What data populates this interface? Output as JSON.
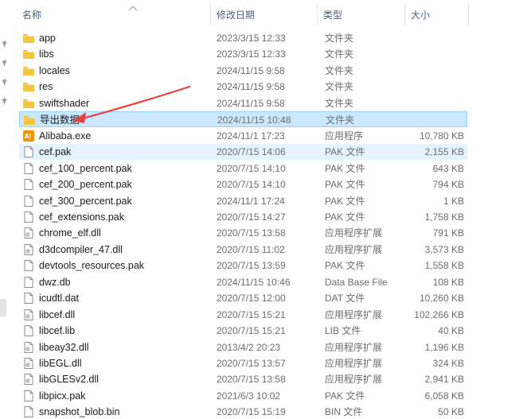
{
  "columns": {
    "name": "名称",
    "date": "修改日期",
    "type": "类型",
    "size": "大小"
  },
  "colors": {
    "folder": "#f5c542",
    "selected_bg": "#cce8ff",
    "hover_bg": "#e5f3ff",
    "arrow": "#e8413b",
    "header_text": "#4c607a"
  },
  "files": [
    {
      "name": "app",
      "date": "2023/3/15 12:33",
      "type": "文件夹",
      "size": "",
      "icon": "folder-icon",
      "state": ""
    },
    {
      "name": "libs",
      "date": "2023/3/15 12:33",
      "type": "文件夹",
      "size": "",
      "icon": "folder-icon",
      "state": ""
    },
    {
      "name": "locales",
      "date": "2024/11/15 9:58",
      "type": "文件夹",
      "size": "",
      "icon": "folder-icon",
      "state": ""
    },
    {
      "name": "res",
      "date": "2024/11/15 9:58",
      "type": "文件夹",
      "size": "",
      "icon": "folder-icon",
      "state": ""
    },
    {
      "name": "swiftshader",
      "date": "2024/11/15 9:58",
      "type": "文件夹",
      "size": "",
      "icon": "folder-icon",
      "state": ""
    },
    {
      "name": "导出数据",
      "date": "2024/11/15 10:48",
      "type": "文件夹",
      "size": "",
      "icon": "folder-icon",
      "state": "selected"
    },
    {
      "name": "Alibaba.exe",
      "date": "2024/11/1 17:23",
      "type": "应用程序",
      "size": "10,780 KB",
      "icon": "alibaba-app-icon",
      "state": ""
    },
    {
      "name": "cef.pak",
      "date": "2020/7/15 14:06",
      "type": "PAK 文件",
      "size": "2,155 KB",
      "icon": "file-icon",
      "state": "hover"
    },
    {
      "name": "cef_100_percent.pak",
      "date": "2020/7/15 14:10",
      "type": "PAK 文件",
      "size": "643 KB",
      "icon": "file-icon",
      "state": ""
    },
    {
      "name": "cef_200_percent.pak",
      "date": "2020/7/15 14:10",
      "type": "PAK 文件",
      "size": "794 KB",
      "icon": "file-icon",
      "state": ""
    },
    {
      "name": "cef_300_percent.pak",
      "date": "2024/11/1 17:24",
      "type": "PAK 文件",
      "size": "1 KB",
      "icon": "file-icon",
      "state": ""
    },
    {
      "name": "cef_extensions.pak",
      "date": "2020/7/15 14:27",
      "type": "PAK 文件",
      "size": "1,758 KB",
      "icon": "file-icon",
      "state": ""
    },
    {
      "name": "chrome_elf.dll",
      "date": "2020/7/15 13:58",
      "type": "应用程序扩展",
      "size": "791 KB",
      "icon": "dll-icon",
      "state": ""
    },
    {
      "name": "d3dcompiler_47.dll",
      "date": "2020/7/15 11:02",
      "type": "应用程序扩展",
      "size": "3,573 KB",
      "icon": "dll-icon",
      "state": ""
    },
    {
      "name": "devtools_resources.pak",
      "date": "2020/7/15 13:59",
      "type": "PAK 文件",
      "size": "1,558 KB",
      "icon": "file-icon",
      "state": ""
    },
    {
      "name": "dwz.db",
      "date": "2024/11/15 10:46",
      "type": "Data Base File",
      "size": "108 KB",
      "icon": "file-icon",
      "state": ""
    },
    {
      "name": "icudtl.dat",
      "date": "2020/7/15 12:00",
      "type": "DAT 文件",
      "size": "10,260 KB",
      "icon": "file-icon",
      "state": ""
    },
    {
      "name": "libcef.dll",
      "date": "2020/7/15 15:21",
      "type": "应用程序扩展",
      "size": "102,266 KB",
      "icon": "dll-icon",
      "state": ""
    },
    {
      "name": "libcef.lib",
      "date": "2020/7/15 15:21",
      "type": "LIB 文件",
      "size": "40 KB",
      "icon": "file-icon",
      "state": ""
    },
    {
      "name": "libeay32.dll",
      "date": "2013/4/2 20:23",
      "type": "应用程序扩展",
      "size": "1,196 KB",
      "icon": "dll-icon",
      "state": ""
    },
    {
      "name": "libEGL.dll",
      "date": "2020/7/15 13:57",
      "type": "应用程序扩展",
      "size": "324 KB",
      "icon": "dll-icon",
      "state": ""
    },
    {
      "name": "libGLESv2.dll",
      "date": "2020/7/15 13:58",
      "type": "应用程序扩展",
      "size": "2,941 KB",
      "icon": "dll-icon",
      "state": ""
    },
    {
      "name": "libpicx.pak",
      "date": "2021/6/3 10:02",
      "type": "PAK 文件",
      "size": "6,058 KB",
      "icon": "file-icon",
      "state": ""
    },
    {
      "name": "snapshot_blob.bin",
      "date": "2020/7/15 15:19",
      "type": "BIN 文件",
      "size": "50 KB",
      "icon": "file-icon",
      "state": ""
    }
  ]
}
